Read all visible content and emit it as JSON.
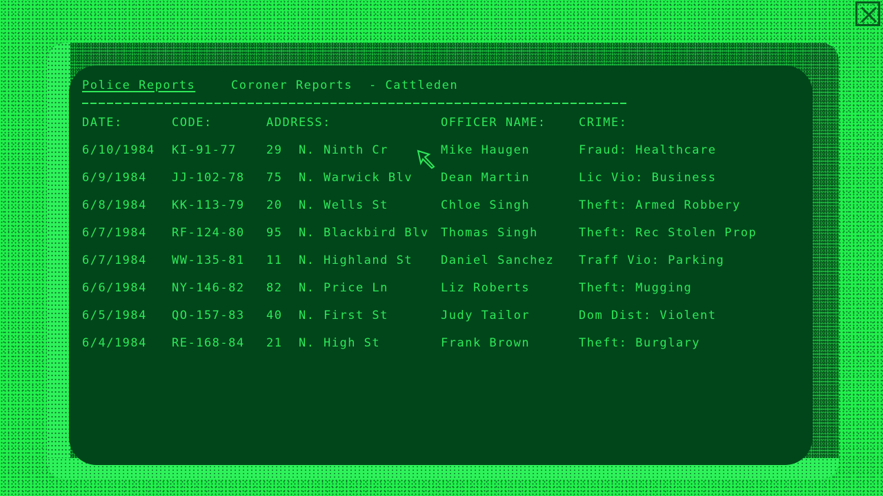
{
  "window": {
    "close_icon": "close-x-icon"
  },
  "tabs": [
    {
      "label": "Police Reports",
      "active": true
    },
    {
      "label": "Coroner Reports",
      "active": false
    }
  ],
  "location": "- Cattleden",
  "table": {
    "headers": {
      "date": "DATE:",
      "code": "CODE:",
      "address": "ADDRESS:",
      "officer": "OFFICER NAME:",
      "crime": "CRIME:"
    },
    "rows": [
      {
        "date": "6/10/1984",
        "code": "KI-91-77",
        "number": "29",
        "dir": "N.",
        "street": "Ninth Cr",
        "officer": "Mike Haugen",
        "crime": "Fraud: Healthcare"
      },
      {
        "date": "6/9/1984",
        "code": "JJ-102-78",
        "number": "75",
        "dir": "N.",
        "street": "Warwick Blv",
        "officer": "Dean Martin",
        "crime": "Lic Vio: Business"
      },
      {
        "date": "6/8/1984",
        "code": "KK-113-79",
        "number": "20",
        "dir": "N.",
        "street": "Wells St",
        "officer": "Chloe Singh",
        "crime": "Theft: Armed Robbery"
      },
      {
        "date": "6/7/1984",
        "code": "RF-124-80",
        "number": "95",
        "dir": "N.",
        "street": "Blackbird Blv",
        "officer": "Thomas Singh",
        "crime": "Theft: Rec Stolen Prop"
      },
      {
        "date": "6/7/1984",
        "code": "WW-135-81",
        "number": "11",
        "dir": "N.",
        "street": "Highland St",
        "officer": "Daniel Sanchez",
        "crime": "Traff Vio: Parking"
      },
      {
        "date": "6/6/1984",
        "code": "NY-146-82",
        "number": "82",
        "dir": "N.",
        "street": "Price Ln",
        "officer": "Liz Roberts",
        "crime": "Theft: Mugging"
      },
      {
        "date": "6/5/1984",
        "code": "QO-157-83",
        "number": "40",
        "dir": "N.",
        "street": "First St",
        "officer": "Judy Tailor",
        "crime": "Dom Dist: Violent"
      },
      {
        "date": "6/4/1984",
        "code": "RE-168-84",
        "number": "21",
        "dir": "N.",
        "street": "High St",
        "officer": "Frank Brown",
        "crime": "Theft: Burglary"
      }
    ]
  },
  "colors": {
    "screen_bg": "#01461a",
    "text": "#2ee85a",
    "bezel": "#22f04c"
  }
}
